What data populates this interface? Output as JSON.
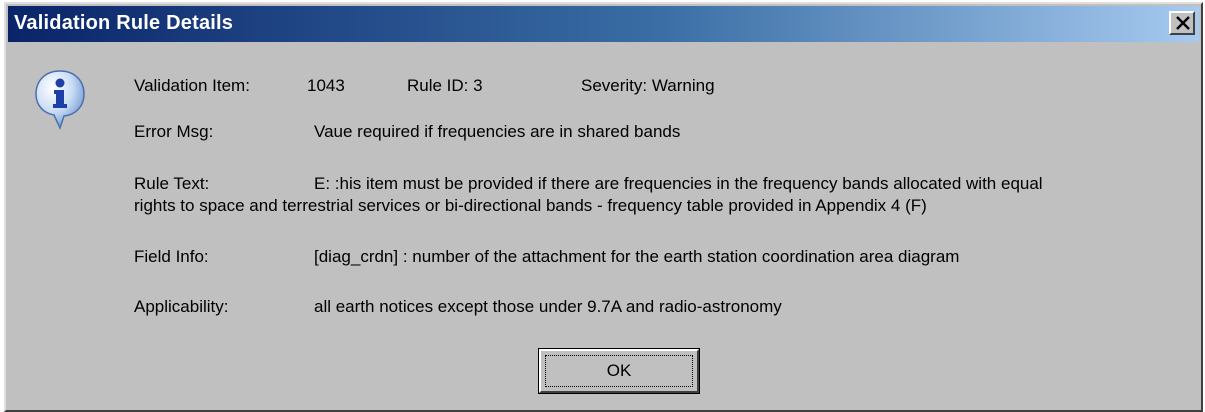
{
  "window": {
    "title": "Validation Rule Details",
    "close_glyph": "✕"
  },
  "icon": {
    "name": "info-icon",
    "glyph": "i"
  },
  "details": {
    "validation_item_label": "Validation Item:",
    "validation_item_value": "1043",
    "rule_id": "Rule ID: 3",
    "severity": "Severity: Warning",
    "error_msg_label": "Error Msg:",
    "error_msg_value": "Vaue required if frequencies are in shared bands",
    "rule_text_label": "Rule Text:",
    "rule_text_line1": "E: :his item must be provided if there are frequencies in the frequency bands allocated with equal",
    "rule_text_line2": "rights to space and terrestrial services or bi-directional bands - frequency table provided in Appendix 4 (F)",
    "field_info_label": "Field Info:",
    "field_info_value": "[diag_crdn] : number of the attachment for the earth station coordination area diagram",
    "applicability_label": "Applicability:",
    "applicability_value": "all earth notices except those under 9.7A and radio-astronomy"
  },
  "buttons": {
    "ok_label": "OK"
  }
}
